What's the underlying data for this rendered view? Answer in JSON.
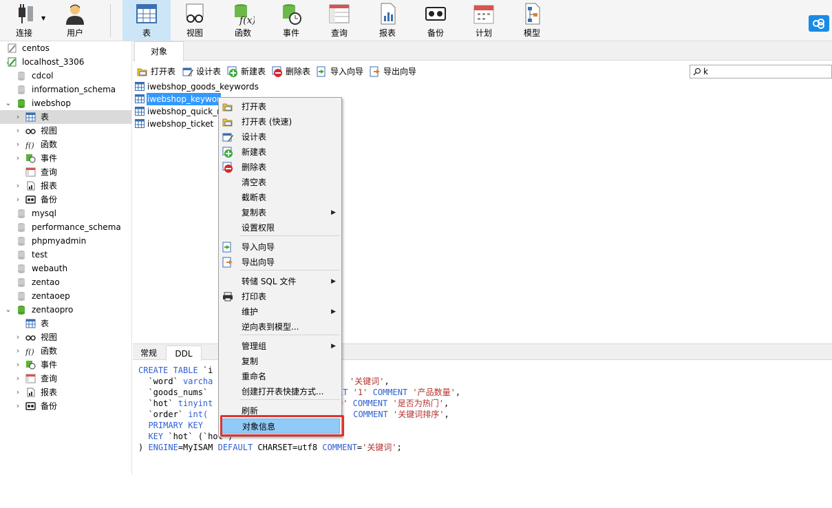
{
  "toolbar": {
    "connect": "连接",
    "user": "用户",
    "table": "表",
    "view": "视图",
    "function": "函数",
    "event": "事件",
    "query": "查询",
    "report": "报表",
    "backup": "备份",
    "schedule": "计划",
    "model": "模型",
    "active": "表"
  },
  "nav": {
    "items": [
      {
        "label": "centos"
      },
      {
        "label": "localhost_3306"
      },
      {
        "label": "cdcol"
      },
      {
        "label": "information_schema"
      },
      {
        "label": "iwebshop"
      },
      {
        "label": "表"
      },
      {
        "label": "视图"
      },
      {
        "label": "函数"
      },
      {
        "label": "事件"
      },
      {
        "label": "查询"
      },
      {
        "label": "报表"
      },
      {
        "label": "备份"
      },
      {
        "label": "mysql"
      },
      {
        "label": "performance_schema"
      },
      {
        "label": "phpmyadmin"
      },
      {
        "label": "test"
      },
      {
        "label": "webauth"
      },
      {
        "label": "zentao"
      },
      {
        "label": "zentaoep"
      },
      {
        "label": "zentaopro"
      },
      {
        "label": "表"
      },
      {
        "label": "视图"
      },
      {
        "label": "函数"
      },
      {
        "label": "事件"
      },
      {
        "label": "查询"
      },
      {
        "label": "报表"
      },
      {
        "label": "备份"
      }
    ]
  },
  "tabs": {
    "objects": "对象"
  },
  "object_toolbar": {
    "open_table": "打开表",
    "design_table": "设计表",
    "new_table": "新建表",
    "delete_table": "删除表",
    "import_wizard": "导入向导",
    "export_wizard": "导出向导"
  },
  "search": {
    "value": "k"
  },
  "objects": [
    {
      "name": "iwebshop_goods_keywords"
    },
    {
      "name": "iwebshop_keywor"
    },
    {
      "name": "iwebshop_quick_n"
    },
    {
      "name": "iwebshop_ticket"
    }
  ],
  "bottom_tabs": {
    "general": "常规",
    "ddl": "DDL"
  },
  "ddl": {
    "l1_kw": "CREATE TABLE",
    "l1_rest": " `i",
    "l2_a": "  `word` ",
    "l2_kw": "varcha",
    "l2_tail_str": "'关键词'",
    "l2_tail_end": ",",
    "l3_a": "  `goods_nums`",
    "l3_kw": "LT ",
    "l3_num": "'1'",
    "l3_kw2": " COMMENT ",
    "l3_str": "'产品数量'",
    "l3_end": ",",
    "l4_a": "  `hot` ",
    "l4_kw": "tinyint",
    "l4_num": "0'",
    "l4_kw2": " COMMENT ",
    "l4_str": "'是否为热门'",
    "l4_end": ",",
    "l5_a": "  `order` ",
    "l5_kw": "int(",
    "l5_kw2": " COMMENT ",
    "l5_str": "'关键词排序'",
    "l5_end": ",",
    "l6_kw": "  PRIMARY KEY",
    "l7_kw": "  KEY",
    "l7_rest": " `hot` (`hot`)",
    "l8_a": ") ",
    "l8_kw": "ENGINE",
    "l8_b": "=MyISAM ",
    "l8_kw2": "DEFAULT",
    "l8_c": " CHARSET=utf8 ",
    "l8_kw3": "COMMENT",
    "l8_d": "=",
    "l8_str": "'关键词'",
    "l8_e": ";"
  },
  "context_menu": {
    "open_table": "打开表",
    "open_table_fast": "打开表 (快速)",
    "design_table": "设计表",
    "new_table": "新建表",
    "delete_table": "删除表",
    "empty_table": "清空表",
    "truncate_table": "截断表",
    "copy_table": "复制表",
    "set_permissions": "设置权限",
    "import_wizard": "导入向导",
    "export_wizard": "导出向导",
    "dump_sql": "转储 SQL 文件",
    "print_table": "打印表",
    "maintain": "维护",
    "reverse_to_model": "逆向表到模型...",
    "manage_group": "管理组",
    "copy": "复制",
    "rename": "重命名",
    "create_shortcut": "创建打开表快捷方式...",
    "refresh": "刷新",
    "object_info": "对象信息"
  },
  "colors": {
    "selection": "#3399ff",
    "menu_highlight": "#91c9f7",
    "annotation_box": "#e0332c",
    "sql_keyword": "#2f5fd0",
    "sql_string": "#b4322d"
  }
}
